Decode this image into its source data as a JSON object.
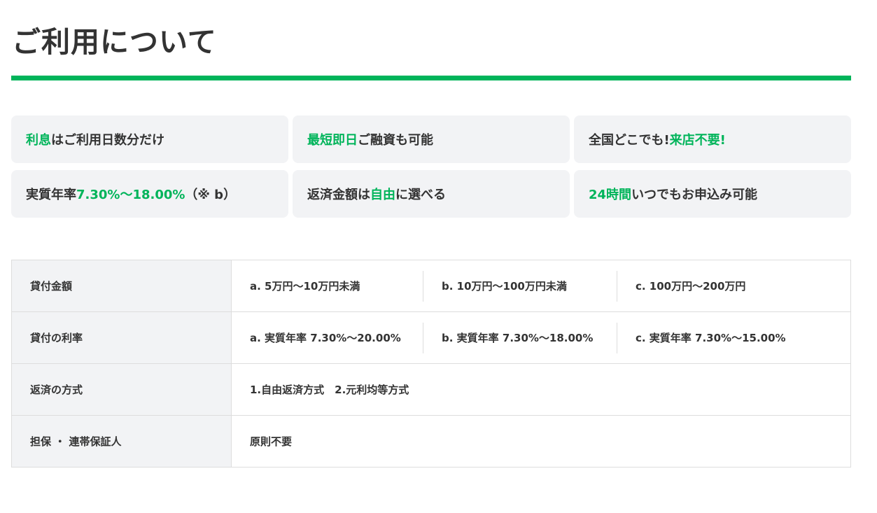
{
  "page": {
    "title": "ご利用について"
  },
  "colors": {
    "accent": "#00b45a",
    "card_bg": "#f2f3f5",
    "text": "#333333",
    "border": "#dddddd"
  },
  "features": [
    {
      "pre": "",
      "highlight": "利息",
      "post": "はご利用日数分だけ"
    },
    {
      "pre": "",
      "highlight": "最短即日",
      "post": "ご融資も可能"
    },
    {
      "pre": "全国どこでも!",
      "highlight": "来店不要!",
      "post": ""
    },
    {
      "pre": "実質年率 ",
      "highlight": "7.30%〜18.00%",
      "post": "（※ b）"
    },
    {
      "pre": "返済金額は",
      "highlight": "自由",
      "post": "に選べる"
    },
    {
      "pre": "",
      "highlight": "24時間",
      "post": "いつでもお申込み可能"
    }
  ],
  "table": {
    "rows": [
      {
        "label": "貸付金額",
        "cells": [
          "a. 5万円〜10万円未満",
          "b. 10万円〜100万円未満",
          "c. 100万円〜200万円"
        ]
      },
      {
        "label": "貸付の利率",
        "cells": [
          "a. 実質年率 7.30%〜20.00%",
          "b. 実質年率 7.30%〜18.00%",
          "c. 実質年率 7.30%〜15.00%"
        ]
      },
      {
        "label": "返済の方式",
        "value": "1.自由返済方式　2.元利均等方式"
      },
      {
        "label": "担保 ・ 連帯保証人",
        "value": "原則不要"
      }
    ]
  }
}
